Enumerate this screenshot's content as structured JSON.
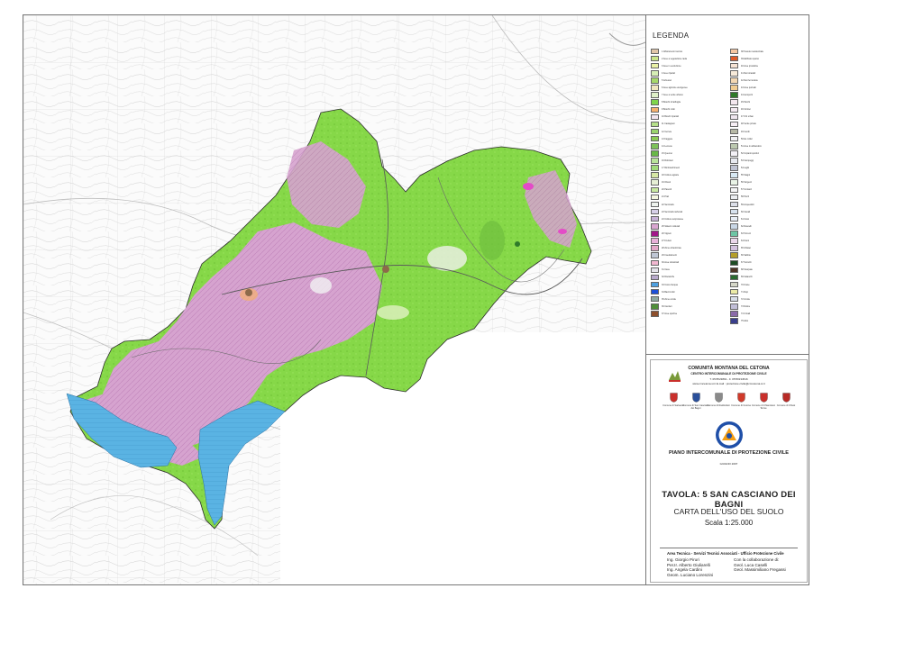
{
  "legend": {
    "title": "LEGENDA",
    "left_items": [
      {
        "label": "1 Affioramenti rocciosi",
        "color": "#e2c6a8"
      },
      {
        "label": "2 Aree a vegetazione rada",
        "color": "#cbe58a"
      },
      {
        "label": "3 Aree in evoluzione",
        "color": "#e9f1a6"
      },
      {
        "label": "4 Aree ripariali",
        "color": "#d6eeb5"
      },
      {
        "label": "5 Arbusteti",
        "color": "#a6d86b"
      },
      {
        "label": "6 Aree agricole eterogenee",
        "color": "#f0e7bf"
      },
      {
        "label": "7 Aree a verde urbano",
        "color": "#dff0c8"
      },
      {
        "label": "8 Boschi di latifoglie",
        "color": "#7fd44c"
      },
      {
        "label": "9 Boschi misti",
        "color": "#f5b06e"
      },
      {
        "label": "10 Boschi ripariali",
        "color": "#f3e6ef"
      },
      {
        "label": "11 Castagneti",
        "color": "#b6e08a"
      },
      {
        "label": "12 Cerrete",
        "color": "#9bd46e"
      },
      {
        "label": "13 Faggete",
        "color": "#8ccc55"
      },
      {
        "label": "14 Leccete",
        "color": "#7ec25a"
      },
      {
        "label": "15 Querceti",
        "color": "#69b847"
      },
      {
        "label": "16 Robinieti",
        "color": "#b8e39a"
      },
      {
        "label": "17 Rimboschimenti",
        "color": "#a0da7a"
      },
      {
        "label": "18 Colture agrarie",
        "color": "#d7e7a5"
      },
      {
        "label": "19 Oliveti",
        "color": "#e6efd5"
      },
      {
        "label": "20 Pascoli",
        "color": "#c8e9a0"
      },
      {
        "label": "21 Prati",
        "color": "#f4f7df"
      },
      {
        "label": "22 Seminativi",
        "color": "#eef3ee"
      },
      {
        "label": "23 Seminativi arborati",
        "color": "#d6cfe8"
      },
      {
        "label": "24 Colture temporanee",
        "color": "#c6b1d6"
      },
      {
        "label": "25 Sistemi colturali",
        "color": "#d9a6d0"
      },
      {
        "label": "26 Vigneti",
        "color": "#a2178a"
      },
      {
        "label": "27 Frutteti",
        "color": "#e8b0d9"
      },
      {
        "label": "28 Zone urbanizzate",
        "color": "#e3a8c9"
      },
      {
        "label": "29 Insediamenti",
        "color": "#bfc6d4"
      },
      {
        "label": "30 Aree industriali",
        "color": "#f1b7d0"
      },
      {
        "label": "31 Cave",
        "color": "#e4e3ea"
      },
      {
        "label": "32 Discariche",
        "color": "#b8a9cc"
      },
      {
        "label": "33 Corsi d'acqua",
        "color": "#4ea0e0"
      },
      {
        "label": "34 Bacini idrici",
        "color": "#1c4fd8"
      },
      {
        "label": "35 Zone umide",
        "color": "#8fa9a0"
      },
      {
        "label": "36 Cantieri",
        "color": "#4f8f3a"
      },
      {
        "label": "37 Aree sportive",
        "color": "#8d4f2c"
      }
    ],
    "right_items": [
      {
        "label": "38 Tessuto residenziale",
        "color": "#f6c6a1"
      },
      {
        "label": "39 Edificato sparso",
        "color": "#e05b2a"
      },
      {
        "label": "40 Aree produttive",
        "color": "#f6e3d4"
      },
      {
        "label": "41 Reti stradali",
        "color": "#f7ead9"
      },
      {
        "label": "42 Reti ferroviarie",
        "color": "#f3d7b2"
      },
      {
        "label": "43 Aree portuali",
        "color": "#f0cc92"
      },
      {
        "label": "44 Aeroporti",
        "color": "#2f7a2a"
      },
      {
        "label": "45 Parchi",
        "color": "#f3e7ee"
      },
      {
        "label": "46 Cimiteri",
        "color": "#f4e9f1"
      },
      {
        "label": "47 Orti urbani",
        "color": "#efe6ef"
      },
      {
        "label": "48 Verde privato",
        "color": "#f6eef4"
      },
      {
        "label": "49 Incolti",
        "color": "#b7b9a6"
      },
      {
        "label": "50 Ex coltivi",
        "color": "#f1f1f3"
      },
      {
        "label": "51 Aree in abbandono",
        "color": "#bcc8b0"
      },
      {
        "label": "52 Impianti sportivi",
        "color": "#f3f1f6"
      },
      {
        "label": "53 Campeggi",
        "color": "#e7e9ef"
      },
      {
        "label": "54 Laghi",
        "color": "#bfc3d2"
      },
      {
        "label": "55 Stagni",
        "color": "#d8e9f3"
      },
      {
        "label": "56 Sorgenti",
        "color": "#e9f3e6"
      },
      {
        "label": "57 Fontanili",
        "color": "#f5f5f6"
      },
      {
        "label": "58 Pozzi",
        "color": "#ebedf1"
      },
      {
        "label": "59 Acquedotti",
        "color": "#dcdfe8"
      },
      {
        "label": "60 Canali",
        "color": "#d7e2ee"
      },
      {
        "label": "61 Fossi",
        "color": "#e8eef6"
      },
      {
        "label": "62 Ruscelli",
        "color": "#c9d7e6"
      },
      {
        "label": "63 Torrenti",
        "color": "#6ec5a4"
      },
      {
        "label": "64 Fiumi",
        "color": "#ead7ea"
      },
      {
        "label": "65 Ghiaieti",
        "color": "#d3c2de"
      },
      {
        "label": "66 Sabbie",
        "color": "#b49e2a"
      },
      {
        "label": "67 Terrazzi",
        "color": "#1d4c24"
      },
      {
        "label": "68 Scarpate",
        "color": "#4e3424"
      },
      {
        "label": "69 Calanchi",
        "color": "#2a6a2f"
      },
      {
        "label": "70 Frane",
        "color": "#d5d7c8"
      },
      {
        "label": "71 Rupi",
        "color": "#ebeaa6"
      },
      {
        "label": "72 Grotte",
        "color": "#d9dfe9"
      },
      {
        "label": "73 Doline",
        "color": "#c2bfd8"
      },
      {
        "label": "74 Crinali",
        "color": "#8a6aa8"
      },
      {
        "label": "75 Altro",
        "color": "#3a3f8c"
      }
    ]
  },
  "title_block": {
    "org": "COMUNITÀ MONTANA DEL CETONA",
    "centre": "CENTRO INTERCOMUNALE DI PROTEZIONE CIVILE",
    "contact1": "T. 0578/23891 - F. 0578/234516",
    "contact2": "www.cmcetona.si.it E-mail : protezione.civile@cmcetona.si.it",
    "logo_text": "Comunità Montana Cetona",
    "crests": [
      {
        "caption": "Comune di Sarteano",
        "color": "#c9302c"
      },
      {
        "caption": "Comune di San Casciano dei Bagni",
        "color": "#2a4f9a"
      },
      {
        "caption": "Comune di Radicofani",
        "color": "#8a8a8a"
      },
      {
        "caption": "Comune di Cetona",
        "color": "#d03a2a"
      },
      {
        "caption": "Comune di Chianciano Terme",
        "color": "#c9302c"
      },
      {
        "caption": "Comune di Chiusi",
        "color": "#b82a26"
      }
    ],
    "plan": "PIANO INTERCOMUNALE DI PROTEZIONE CIVILE",
    "date": "GIUGNO 2007",
    "tavola": "TAVOLA: 5 SAN CASCIANO DEI BAGNI",
    "carta": "CARTA DELL'USO DEL SUOLO",
    "scala": "Scala    1:25.000",
    "area": "Area Tecnica - Servizi Tecnici Associati - Ufficio Protezione Civile",
    "left_names": [
      "Ing. Giorgio Piruri",
      "Per.Ir. Alberto Giuliarelli",
      "Ing. Angela Cardini",
      "Geom. Luciano Lorenzini"
    ],
    "right_names": [
      "Con la collaborazione di:",
      "Geol. Luca Caselli",
      "Geol. Massimiliano Fregassi"
    ]
  },
  "colors": {
    "woodland": "#86d848",
    "agricultural": "#d8a6cf",
    "lake": "#5ab3e3",
    "topo_line": "#b9b9b9",
    "road": "#606060"
  }
}
